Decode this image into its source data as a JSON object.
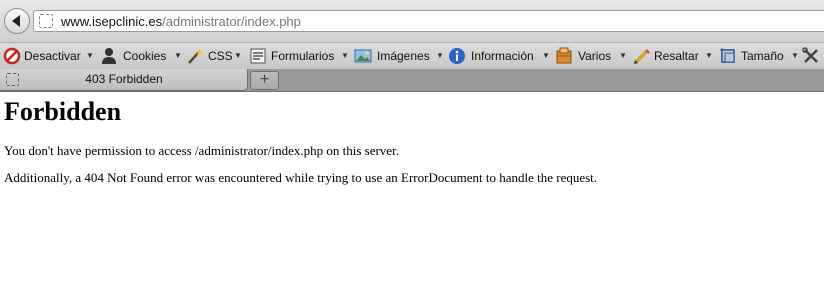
{
  "browser": {
    "url_host": "www.isepclinic.es",
    "url_path": "/administrator/index.php"
  },
  "dev_toolbar": {
    "items": [
      {
        "label": "Desactivar",
        "icon": "disable-icon"
      },
      {
        "label": "Cookies",
        "icon": "cookies-icon"
      },
      {
        "label": "CSS",
        "icon": "css-wand-icon"
      },
      {
        "label": "Formularios",
        "icon": "forms-icon"
      },
      {
        "label": "Imágenes",
        "icon": "images-icon"
      },
      {
        "label": "Información",
        "icon": "info-icon"
      },
      {
        "label": "Varios",
        "icon": "misc-icon"
      },
      {
        "label": "Resaltar",
        "icon": "outline-pencil-icon"
      },
      {
        "label": "Tamaño",
        "icon": "resize-icon"
      }
    ],
    "tools_icon": "tools-icon"
  },
  "tabs": [
    {
      "title": "403 Forbidden",
      "active": true
    }
  ],
  "new_tab_label": "+",
  "page": {
    "heading": "Forbidden",
    "message": "You don't have permission to access /administrator/index.php on this server.",
    "additional": "Additionally, a 404 Not Found error was encountered while trying to use an ErrorDocument to handle the request."
  }
}
